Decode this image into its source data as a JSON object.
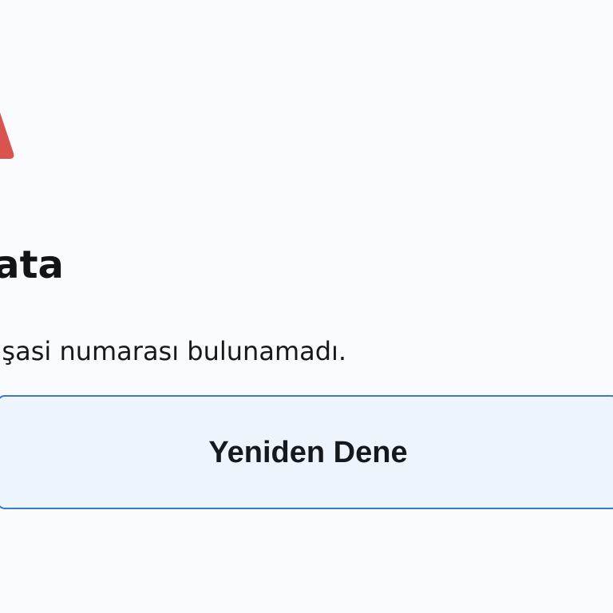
{
  "error": {
    "title": "Hata",
    "message": "Araç şasi numarası bulunamadı.",
    "icon": "warning-triangle-icon",
    "icon_color": "#d9534f"
  },
  "actions": {
    "retry_label": "Yeniden Dene"
  },
  "theme": {
    "background": "#f8fafd",
    "button_border": "#3f79bd",
    "button_background": "#edf4fc"
  }
}
